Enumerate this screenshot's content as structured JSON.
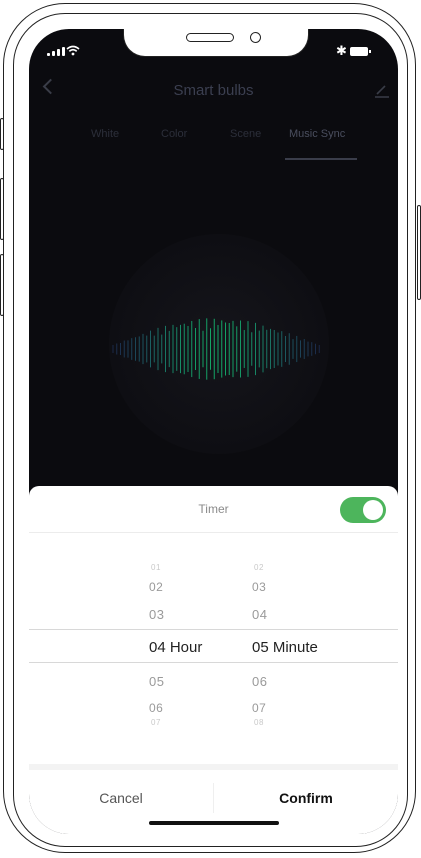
{
  "header": {
    "title": "Smart bulbs"
  },
  "tabs": [
    {
      "label": "White"
    },
    {
      "label": "Color"
    },
    {
      "label": "Scene"
    },
    {
      "label": "Music Sync",
      "active": true
    }
  ],
  "timer_sheet": {
    "title": "Timer",
    "enabled": true,
    "toggle_color": "#4db55c",
    "hours": [
      "01",
      "02",
      "03",
      "04 Hour",
      "05",
      "06",
      "07"
    ],
    "minutes": [
      "02",
      "03",
      "04",
      "05 Minute",
      "06",
      "07",
      "08"
    ],
    "cancel_label": "Cancel",
    "confirm_label": "Confirm"
  },
  "icons": {
    "back": "chevron-left-icon",
    "edit": "pencil-icon",
    "signal": "cellular-signal-icon",
    "wifi": "wifi-icon",
    "bluetooth": "bluetooth-icon",
    "battery": "battery-icon"
  }
}
